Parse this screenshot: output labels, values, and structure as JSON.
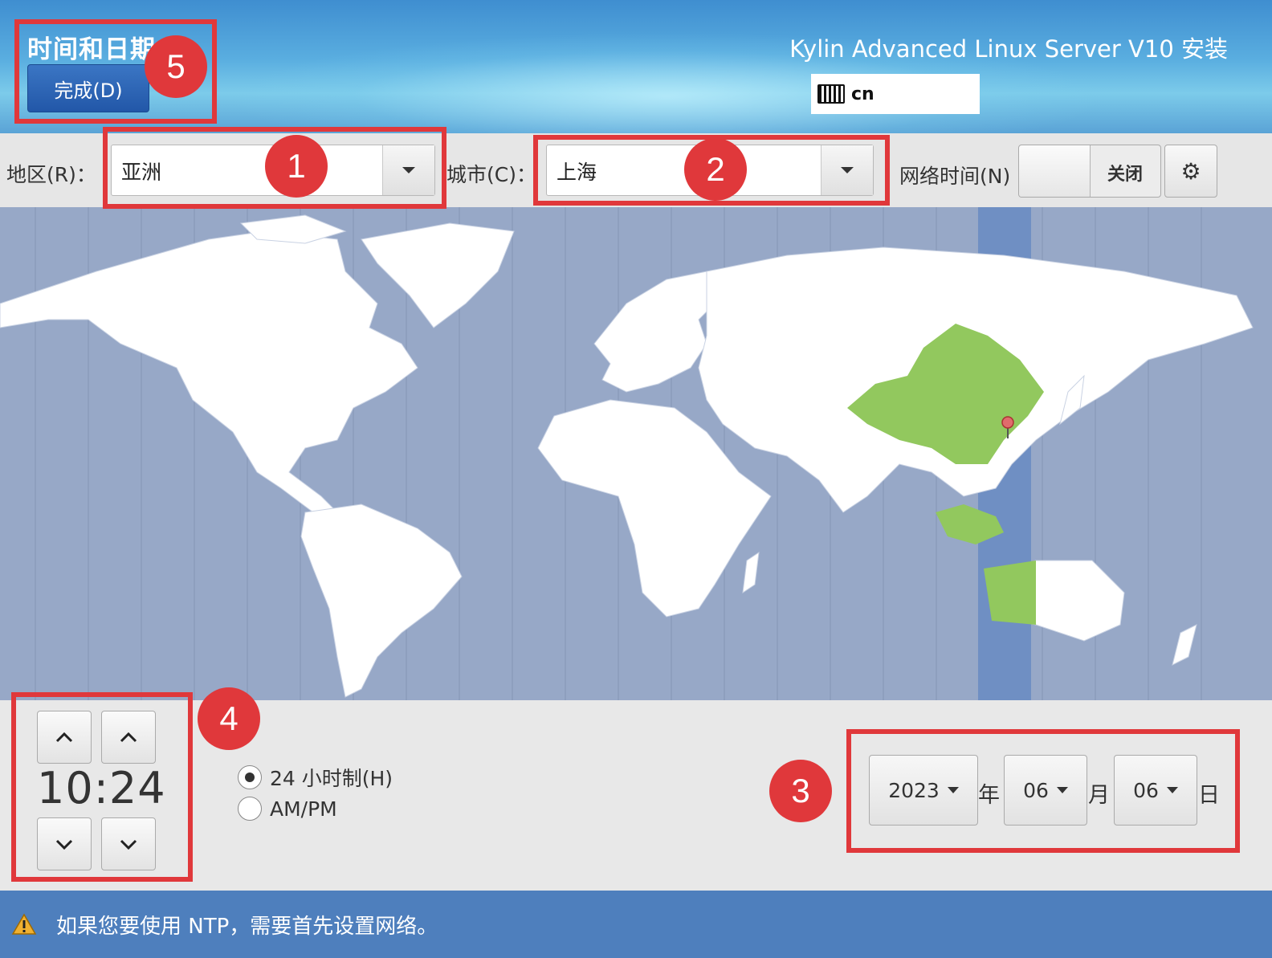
{
  "header": {
    "title": "时间和日期",
    "done_button": "完成(D)",
    "product": "Kylin Advanced Linux Server V10 安装",
    "keyboard_layout": "cn"
  },
  "selectors": {
    "region_label": "地区(R)：",
    "region_value": "亚洲",
    "city_label": "城市(C)：",
    "city_value": "上海",
    "network_time_label": "网络时间(N)",
    "network_time_state": "关闭"
  },
  "time": {
    "display": "10:24",
    "format_24h_label": "24 小时制(H)",
    "format_ampm_label": "AM/PM",
    "selected_format": "24h"
  },
  "date": {
    "year": "2023",
    "year_unit": "年",
    "month": "06",
    "month_unit": "月",
    "day": "06",
    "day_unit": "日"
  },
  "status": {
    "message": "如果您要使用 NTP，需要首先设置网络。"
  },
  "annotations": [
    "1",
    "2",
    "3",
    "4",
    "5"
  ],
  "colors": {
    "header_blue": "#4a9ad6",
    "map_ocean": "#97a8c7",
    "highlight_zone": "#6f8fc3",
    "selected_country": "#92c85e",
    "status_bar": "#4e7fbd",
    "annotation_red": "#e0383b"
  }
}
